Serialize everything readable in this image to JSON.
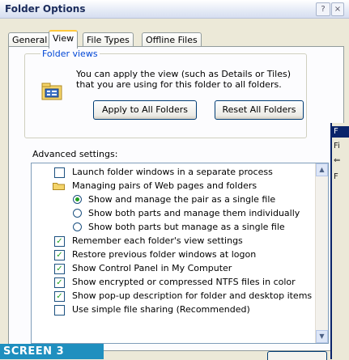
{
  "window": {
    "title": "Folder Options",
    "help_btn": "?",
    "close_btn": "×"
  },
  "tabs": [
    {
      "label": "General"
    },
    {
      "label": "View",
      "active": true
    },
    {
      "label": "File Types"
    },
    {
      "label": "Offline Files"
    }
  ],
  "folder_views": {
    "legend": "Folder views",
    "icon": "folder-view-icon",
    "text": "You can apply the view (such as Details or Tiles) that you are using for this folder to all folders.",
    "apply_button": "Apply to All Folders",
    "reset_button": "Reset All Folders"
  },
  "advanced": {
    "label": "Advanced settings:",
    "items": [
      {
        "type": "checkbox",
        "checked": false,
        "label": "Launch folder windows in a separate process"
      },
      {
        "type": "folder",
        "icon": "folder-icon",
        "label": "Managing pairs of Web pages and folders"
      },
      {
        "type": "radio",
        "checked": true,
        "label": "Show and manage the pair as a single file"
      },
      {
        "type": "radio",
        "checked": false,
        "label": "Show both parts and manage them individually"
      },
      {
        "type": "radio",
        "checked": false,
        "label": "Show both parts but manage as a single file"
      },
      {
        "type": "checkbox",
        "checked": true,
        "label": "Remember each folder's view settings"
      },
      {
        "type": "checkbox",
        "checked": true,
        "label": "Restore previous folder windows at logon"
      },
      {
        "type": "checkbox",
        "checked": true,
        "label": "Show Control Panel in My Computer"
      },
      {
        "type": "checkbox",
        "checked": true,
        "label": "Show encrypted or compressed NTFS files in color"
      },
      {
        "type": "checkbox",
        "checked": true,
        "label": "Show pop-up description for folder and desktop items"
      },
      {
        "type": "checkbox",
        "checked": false,
        "label": "Use simple file sharing (Recommended)"
      }
    ]
  },
  "bg_window": {
    "strips": [
      "F",
      "Fi",
      "⇐",
      "F"
    ]
  },
  "banner": "SCREEN 3",
  "colors": {
    "accent": "#0046d5",
    "banner": "#1f8fbf",
    "check": "#21a121"
  }
}
